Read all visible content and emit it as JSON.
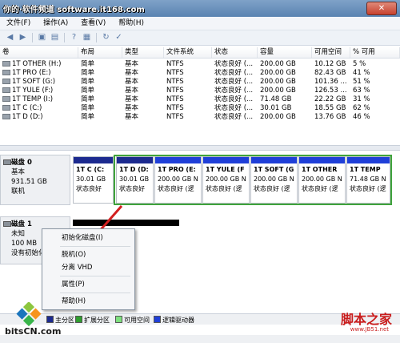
{
  "window": {
    "watermark_text": "你的·软件频道 software.it168.com",
    "close_label": "✕"
  },
  "menu": [
    "文件(F)",
    "操作(A)",
    "查看(V)",
    "帮助(H)"
  ],
  "table": {
    "headers": [
      "卷",
      "布局",
      "类型",
      "文件系统",
      "状态",
      "容量",
      "可用空间",
      "% 可用"
    ],
    "rows": [
      {
        "volume": "1T OTHER (H:)",
        "layout": "简单",
        "type": "基本",
        "fs": "NTFS",
        "status": "状态良好 (...",
        "capacity": "200.00 GB",
        "free": "10.12 GB",
        "pct": "5 %"
      },
      {
        "volume": "1T PRO (E:)",
        "layout": "简单",
        "type": "基本",
        "fs": "NTFS",
        "status": "状态良好 (...",
        "capacity": "200.00 GB",
        "free": "82.43 GB",
        "pct": "41 %"
      },
      {
        "volume": "1T SOFT (G:)",
        "layout": "简单",
        "type": "基本",
        "fs": "NTFS",
        "status": "状态良好 (...",
        "capacity": "200.00 GB",
        "free": "101.36 ...",
        "pct": "51 %"
      },
      {
        "volume": "1T YULE (F:)",
        "layout": "简单",
        "type": "基本",
        "fs": "NTFS",
        "status": "状态良好 (...",
        "capacity": "200.00 GB",
        "free": "126.53 ...",
        "pct": "63 %"
      },
      {
        "volume": "1T TEMP (I:)",
        "layout": "简单",
        "type": "基本",
        "fs": "NTFS",
        "status": "状态良好 (...",
        "capacity": "71.48 GB",
        "free": "22.22 GB",
        "pct": "31 %"
      },
      {
        "volume": "1T C (C:)",
        "layout": "简单",
        "type": "基本",
        "fs": "NTFS",
        "status": "状态良好 (...",
        "capacity": "30.01 GB",
        "free": "18.55 GB",
        "pct": "62 %"
      },
      {
        "volume": "1T D (D:)",
        "layout": "简单",
        "type": "基本",
        "fs": "NTFS",
        "status": "状态良好 (...",
        "capacity": "200.00 GB",
        "free": "13.76 GB",
        "pct": "46 %"
      }
    ]
  },
  "disk0": {
    "name": "磁盘 0",
    "type": "基本",
    "size": "931.51 GB",
    "state": "联机",
    "partitions": [
      {
        "name": "1T C (C:",
        "size": "30.01 GB",
        "status": "状态良好"
      },
      {
        "name": "1T D (D:",
        "size": "30.01 GB",
        "status": "状态良好"
      },
      {
        "name": "1T PRO (E:",
        "size": "200.00 GB N",
        "status": "状态良好 (逻"
      },
      {
        "name": "1T YULE (F",
        "size": "200.00 GB N",
        "status": "状态良好 (逻"
      },
      {
        "name": "1T SOFT (G",
        "size": "200.00 GB N",
        "status": "状态良好 (逻"
      },
      {
        "name": "1T OTHER",
        "size": "200.00 GB N",
        "status": "状态良好 (逻"
      },
      {
        "name": "1T TEMP",
        "size": "71.48 GB N",
        "status": "状态良好 (逻"
      }
    ]
  },
  "disk1": {
    "name": "磁盘 1",
    "type": "未知",
    "size": "100 MB",
    "state": "没有初始化"
  },
  "context_menu": [
    "初始化磁盘(I)",
    "脱机(O)",
    "分离 VHD",
    "属性(P)",
    "帮助(H)"
  ],
  "legend": [
    {
      "label": "主分区",
      "color": "#1c2a8f"
    },
    {
      "label": "扩展分区",
      "color": "#2f9e2f"
    },
    {
      "label": "可用空间",
      "color": "#7ee07e"
    },
    {
      "label": "逻辑驱动器",
      "color": "#1f3fd8"
    }
  ],
  "watermarks": {
    "left": "bitsCN.com",
    "right": "脚本之家",
    "right_sub": "www.JB51.net"
  }
}
